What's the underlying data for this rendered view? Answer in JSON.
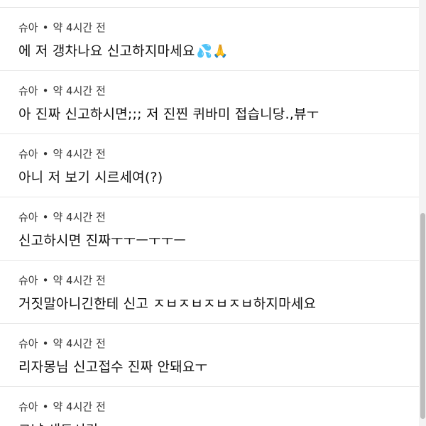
{
  "comments": [
    {
      "author": "슈아",
      "separator": "•",
      "time": "약 4시간 전",
      "text": "에 저 갱차나요 신고하지마세요",
      "emojis": "💦🙏"
    },
    {
      "author": "슈아",
      "separator": "•",
      "time": "약 4시간 전",
      "text": "아 진짜 신고하시면;;; 저 진찐 퀴바미 접습니당.,뷰ㅜ"
    },
    {
      "author": "슈아",
      "separator": "•",
      "time": "약 4시간 전",
      "text": "아니 저 보기 시르세여(?)"
    },
    {
      "author": "슈아",
      "separator": "•",
      "time": "약 4시간 전",
      "text": "신고하시면 진짜ㅜㅜㅡㅜㅜㅡ"
    },
    {
      "author": "슈아",
      "separator": "•",
      "time": "약 4시간 전",
      "text": "거짓말아니긴한테 신고 ㅈㅂㅈㅂㅈㅂㅈㅂ하지마세요"
    },
    {
      "author": "슈아",
      "separator": "•",
      "time": "약 4시간 전",
      "text": "리자몽님 신고접수 진짜 안돼요ㅜ"
    },
    {
      "author": "슈아",
      "separator": "•",
      "time": "약 4시간 전",
      "text": "그냥 새도시긴"
    }
  ]
}
